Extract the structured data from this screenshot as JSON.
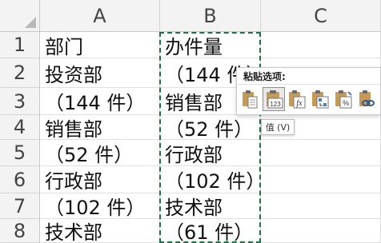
{
  "columns": [
    "A",
    "B",
    "C"
  ],
  "rows": [
    "1",
    "2",
    "3",
    "4",
    "5",
    "6",
    "7",
    "8"
  ],
  "cells": {
    "A": [
      "部门",
      "投资部",
      "（144 件）",
      "销售部",
      "（52 件）",
      "行政部",
      "（102 件）",
      "技术部"
    ],
    "B": [
      "办件量",
      "（144 件）",
      "销售部",
      "（52 件）",
      "行政部",
      "（102 件）",
      "技术部",
      "（61 件）"
    ]
  },
  "paste_popup": {
    "title": "粘贴选项:",
    "options": [
      {
        "icon": "paste-icon",
        "selected": false
      },
      {
        "icon": "paste-values-icon",
        "label": "123",
        "selected": true
      },
      {
        "icon": "paste-formulas-icon",
        "label": "fx",
        "selected": false
      },
      {
        "icon": "paste-transpose-icon",
        "selected": false
      },
      {
        "icon": "paste-formatting-icon",
        "label": "%",
        "selected": false
      },
      {
        "icon": "paste-link-icon",
        "selected": false
      }
    ]
  },
  "tooltip": "值 (V)",
  "colors": {
    "marquee": "#1e7145",
    "header_bg": "#f3f3f3",
    "clipboard": "#c79a55"
  }
}
